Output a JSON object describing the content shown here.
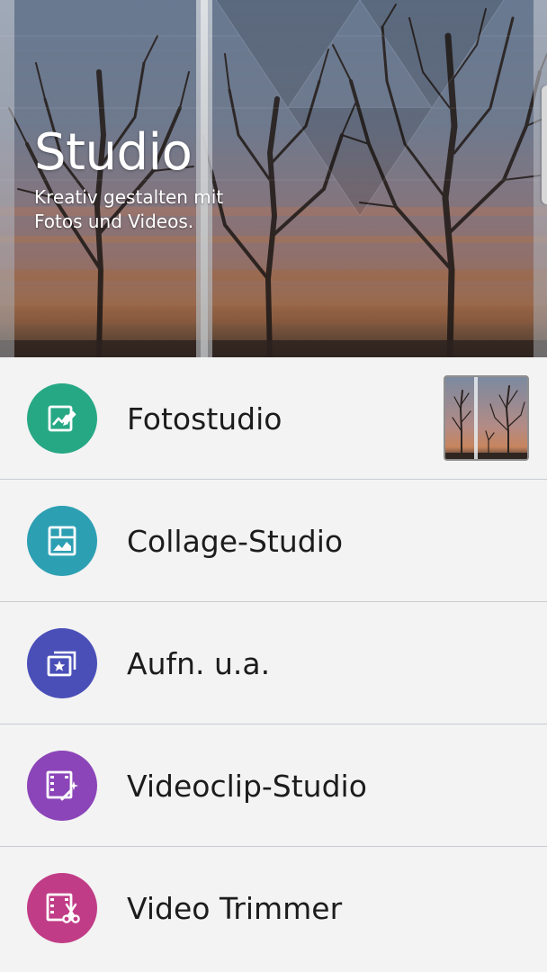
{
  "header": {
    "title": "Studio",
    "subtitle_line1": "Kreativ gestalten mit",
    "subtitle_line2": "Fotos und Videos."
  },
  "menu": {
    "items": [
      {
        "label": "Fotostudio",
        "icon": "photo-edit-icon",
        "color": "#27a884"
      },
      {
        "label": "Collage-Studio",
        "icon": "collage-icon",
        "color": "#2d9fb3"
      },
      {
        "label": "Aufn. u.a.",
        "icon": "slideshow-star-icon",
        "color": "#4a4fb8"
      },
      {
        "label": "Videoclip-Studio",
        "icon": "video-magic-icon",
        "color": "#8b45b8"
      },
      {
        "label": "Video Trimmer",
        "icon": "video-scissors-icon",
        "color": "#c13c86"
      }
    ]
  },
  "thumbnail": {
    "icon": "recent-photo-thumbnail"
  }
}
